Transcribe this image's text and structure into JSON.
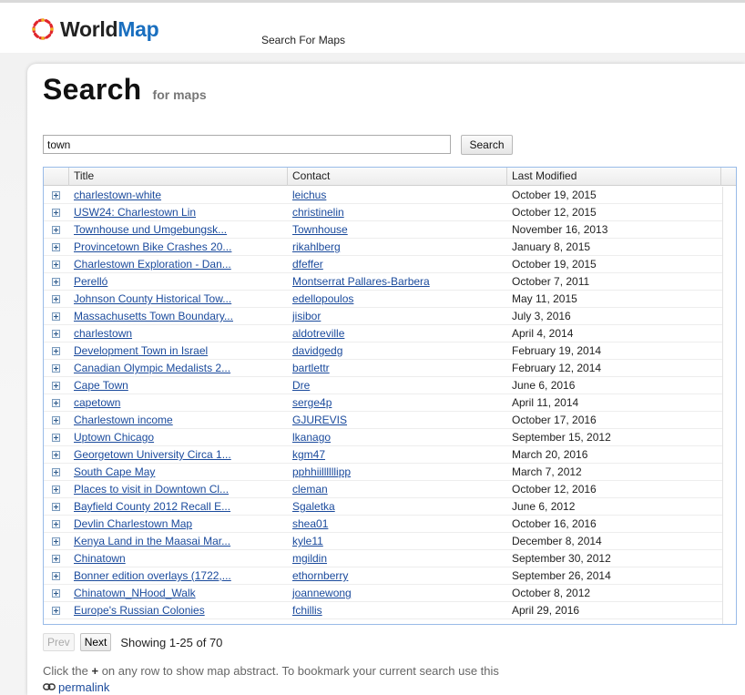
{
  "brand": {
    "name_part1": "World",
    "name_part2": "Map",
    "accent": "#1a6fbf"
  },
  "nav": {
    "search_for_maps": "Search For Maps"
  },
  "page": {
    "title": "Search",
    "subtitle": "for maps"
  },
  "search": {
    "value": "town",
    "button_label": "Search"
  },
  "grid": {
    "columns": {
      "title": "Title",
      "contact": "Contact",
      "last_modified": "Last Modified"
    },
    "rows": [
      {
        "title": "charlestown-white",
        "contact": "leichus",
        "modified": "October 19, 2015"
      },
      {
        "title": "USW24: Charlestown Lin",
        "contact": "christinelin",
        "modified": "October 12, 2015"
      },
      {
        "title": "Townhouse und Umgebungsk...",
        "contact": "Townhouse",
        "modified": "November 16, 2013"
      },
      {
        "title": "Provincetown Bike Crashes 20...",
        "contact": "rikahlberg",
        "modified": "January 8, 2015"
      },
      {
        "title": "Charlestown Exploration - Dan...",
        "contact": "dfeffer",
        "modified": "October 19, 2015"
      },
      {
        "title": "Perelló",
        "contact": "Montserrat Pallares-Barbera",
        "modified": "October 7, 2011"
      },
      {
        "title": "Johnson County Historical Tow...",
        "contact": "edellopoulos",
        "modified": "May 11, 2015"
      },
      {
        "title": "Massachusetts Town Boundary...",
        "contact": "jisibor",
        "modified": "July 3, 2016"
      },
      {
        "title": "charlestown",
        "contact": "aldotreville",
        "modified": "April 4, 2014"
      },
      {
        "title": "Development Town in Israel",
        "contact": "davidgedg",
        "modified": "February 19, 2014"
      },
      {
        "title": "Canadian Olympic Medalists 2...",
        "contact": "bartlettr",
        "modified": "February 12, 2014"
      },
      {
        "title": "Cape Town",
        "contact": "Dre",
        "modified": "June 6, 2016"
      },
      {
        "title": "capetown",
        "contact": "serge4p",
        "modified": "April 11, 2014"
      },
      {
        "title": "Charlestown income",
        "contact": "GJUREVIS",
        "modified": "October 17, 2016"
      },
      {
        "title": "Uptown Chicago",
        "contact": "lkanago",
        "modified": "September 15, 2012"
      },
      {
        "title": "Georgetown University Circa 1...",
        "contact": "kgm47",
        "modified": "March 20, 2016"
      },
      {
        "title": "South Cape May",
        "contact": "pphhiillllllipp",
        "modified": "March 7, 2012"
      },
      {
        "title": "Places to visit in Downtown Cl...",
        "contact": "cleman",
        "modified": "October 12, 2016"
      },
      {
        "title": "Bayfield County 2012 Recall E...",
        "contact": "Sgaletka",
        "modified": "June 6, 2012"
      },
      {
        "title": "Devlin Charlestown Map",
        "contact": "shea01",
        "modified": "October 16, 2016"
      },
      {
        "title": "Kenya Land in the Maasai Mar...",
        "contact": "kyle11",
        "modified": "December 8, 2014"
      },
      {
        "title": "Chinatown",
        "contact": "mgildin",
        "modified": "September 30, 2012"
      },
      {
        "title": "Bonner edition overlays (1722,...",
        "contact": "ethornberry",
        "modified": "September 26, 2014"
      },
      {
        "title": "Chinatown_NHood_Walk",
        "contact": "joannewong",
        "modified": "October 8, 2012"
      },
      {
        "title": "Europe's Russian Colonies",
        "contact": "fchillis",
        "modified": "April 29, 2016"
      }
    ]
  },
  "pager": {
    "prev": "Prev",
    "next": "Next",
    "showing": "Showing 1-25 of 70"
  },
  "footnote": {
    "part1": "Click the",
    "plus": "+",
    "part2": "on any row to show map abstract. To bookmark your current search use this",
    "permalink": "permalink"
  }
}
